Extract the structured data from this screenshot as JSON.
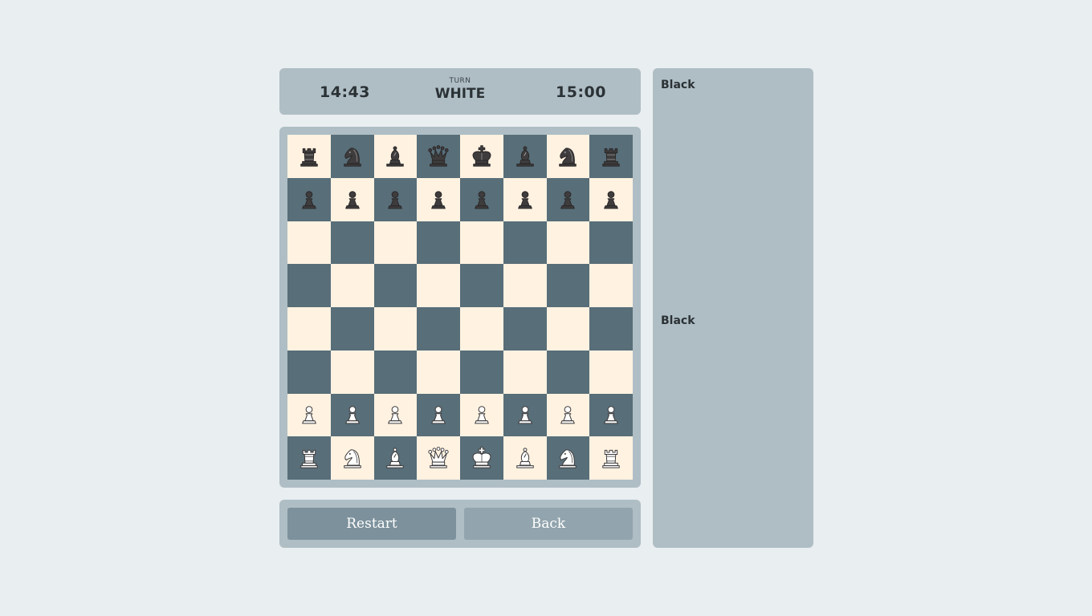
{
  "header": {
    "clock_left": "14:43",
    "turn_label": "TURN",
    "turn_value": "WHITE",
    "clock_right": "15:00"
  },
  "board": {
    "light_color": "#fff2e1",
    "dark_color": "#586e79",
    "ranks": [
      [
        "br",
        "bn",
        "bb",
        "bq",
        "bk",
        "bb",
        "bn",
        "br"
      ],
      [
        "bp",
        "bp",
        "bp",
        "bp",
        "bp",
        "bp",
        "bp",
        "bp"
      ],
      [
        "",
        "",
        "",
        "",
        "",
        "",
        "",
        ""
      ],
      [
        "",
        "",
        "",
        "",
        "",
        "",
        "",
        ""
      ],
      [
        "",
        "",
        "",
        "",
        "",
        "",
        "",
        ""
      ],
      [
        "",
        "",
        "",
        "",
        "",
        "",
        "",
        ""
      ],
      [
        "wp",
        "wp",
        "wp",
        "wp",
        "wp",
        "wp",
        "wp",
        "wp"
      ],
      [
        "wr",
        "wn",
        "wb",
        "wq",
        "wk",
        "wb",
        "wn",
        "wr"
      ]
    ]
  },
  "controls": {
    "restart_label": "Restart",
    "back_label": "Back"
  },
  "side_panel": {
    "top_label": "Black",
    "mid_label": "Black"
  }
}
